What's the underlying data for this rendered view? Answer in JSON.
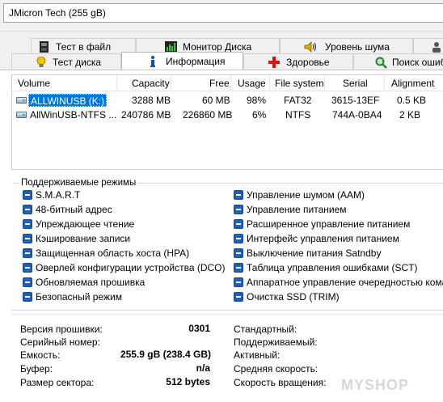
{
  "device": {
    "selected": "JMicron Tech (255 gB)"
  },
  "tabs_top": [
    {
      "label": "Тест в файл",
      "icon": "file-test-icon"
    },
    {
      "label": "Монитор Диска",
      "icon": "disk-monitor-icon"
    },
    {
      "label": "Уровень шума",
      "icon": "speaker-icon"
    }
  ],
  "tabs_bottom": [
    {
      "label": "Тест диска",
      "icon": "lightbulb-icon"
    },
    {
      "label": "Информация",
      "icon": "info-icon",
      "active": true
    },
    {
      "label": "Здоровье",
      "icon": "health-cross-icon"
    },
    {
      "label": "Поиск ошибо",
      "icon": "magnifier-icon"
    }
  ],
  "volumes": {
    "headers": [
      "Volume",
      "Capacity",
      "Free",
      "Usage",
      "File system",
      "Serial",
      "Alignment"
    ],
    "rows": [
      {
        "volume": "ALLWINUSB (K:)",
        "capacity": "3288 MB",
        "free": "60 MB",
        "usage": "98%",
        "fs": "FAT32",
        "serial": "3615-13EF",
        "alignment": "0.5 KB",
        "selected": true
      },
      {
        "volume": "AllWinUSB-NTFS ...",
        "capacity": "240786 MB",
        "free": "226860 MB",
        "usage": "6%",
        "fs": "NTFS",
        "serial": "744A-0BA4",
        "alignment": "2 KB",
        "selected": false
      }
    ]
  },
  "modes": {
    "title": "Поддерживаемые режимы",
    "left": [
      "S.M.A.R.T",
      "48-битный адрес",
      "Упреждающее чтение",
      "Кэширование записи",
      "Защищенная область хоста (HPA)",
      "Оверлей конфигурации устройства (DCO)",
      "Обновляемая прошивка",
      "Безопасный режим"
    ],
    "right": [
      "Управление шумом (AAM)",
      "Управление питанием",
      "Расширенное управление питанием",
      "Интерфейс управления питанием",
      "Выключение питания Satndby",
      "Таблица управления ошибками (SCT)",
      "Аппаратное управление очередностью команд",
      "Очистка SSD (TRIM)"
    ]
  },
  "info": {
    "firmware_label": "Версия прошивки:",
    "firmware_value": "0301",
    "serial_label": "Серийный номер:",
    "serial_value": "",
    "capacity_label": "Емкость:",
    "capacity_value": "255.9 gB (238.4 GB)",
    "buffer_label": "Буфер:",
    "buffer_value": "n/a",
    "sector_label": "Размер сектора:",
    "sector_value": "512 bytes",
    "standard_label": "Стандартный:",
    "supported_label": "Поддерживаемый:",
    "active_label": "Активный:",
    "avg_speed_label": "Средняя скорость:",
    "rotation_label": "Скорость вращения:"
  },
  "watermark": "MYSHOP"
}
